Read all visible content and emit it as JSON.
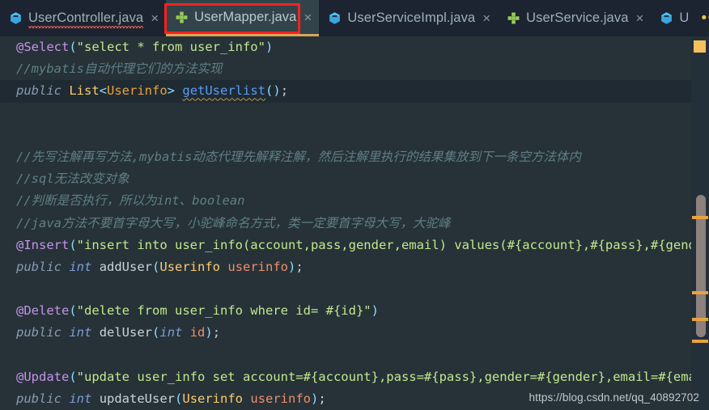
{
  "window": {
    "theme_background": "#263238",
    "tabbar_background": "#1b2430",
    "active_tab_background": "#32444a",
    "active_tab_underline": "#d8a657",
    "annotation_color": "#ff1f1f"
  },
  "tabbar": {
    "tabs": [
      {
        "label": "UserController.java",
        "icon": "java-class-icon",
        "close": "×",
        "active": false,
        "error_squiggle": true
      },
      {
        "label": "UserMapper.java",
        "icon": "mybatis-mapper-icon",
        "close": "×",
        "active": true,
        "error_squiggle": false
      },
      {
        "label": "UserServiceImpl.java",
        "icon": "java-class-icon",
        "close": "×",
        "active": false,
        "error_squiggle": false
      },
      {
        "label": "UserService.java",
        "icon": "mybatis-mapper-icon",
        "close": "×",
        "active": false,
        "error_squiggle": false
      },
      {
        "label": "U",
        "icon": "java-class-icon",
        "close": "",
        "active": false,
        "error_squiggle": false
      }
    ],
    "overflow": {
      "dots": "•••",
      "count": "2"
    }
  },
  "editor": {
    "language": "java",
    "current_line_index": 2,
    "lines": [
      {
        "tokens": [
          {
            "t": "@Select",
            "c": "t-ann"
          },
          {
            "t": "(",
            "c": "t-punc"
          },
          {
            "t": "\"select * from user_info\"",
            "c": "t-str"
          },
          {
            "t": ")",
            "c": "t-punc"
          }
        ]
      },
      {
        "tokens": [
          {
            "t": "//mybatis自动代理它们的方法实现",
            "c": "t-cmt"
          }
        ]
      },
      {
        "tokens": [
          {
            "t": "public",
            "c": "t-kw"
          },
          {
            "t": " ",
            "c": "t-plain"
          },
          {
            "t": "List",
            "c": "t-type"
          },
          {
            "t": "<",
            "c": "t-punc"
          },
          {
            "t": "Userinfo",
            "c": "t-type2"
          },
          {
            "t": ">",
            "c": "t-punc"
          },
          {
            "t": " ",
            "c": "t-plain"
          },
          {
            "t": "getUserlist",
            "c": "t-meth wsq"
          },
          {
            "t": "()",
            "c": "t-punc"
          },
          {
            "t": ";",
            "c": "t-plain"
          }
        ]
      },
      {
        "tokens": []
      },
      {
        "tokens": []
      },
      {
        "tokens": [
          {
            "t": "//先写注解再写方法,mybatis动态代理先解释注解，然后注解里执行的结果集放到下一条空方法体内",
            "c": "t-cmt"
          }
        ]
      },
      {
        "tokens": [
          {
            "t": "//sql无法改变对象",
            "c": "t-cmt"
          }
        ]
      },
      {
        "tokens": [
          {
            "t": "//判断是否执行，所以为int、boolean",
            "c": "t-cmt"
          }
        ]
      },
      {
        "tokens": [
          {
            "t": "//java方法不要首字母大写，小驼峰命名方式，类一定要首字母大写，大驼峰",
            "c": "t-cmt"
          }
        ]
      },
      {
        "tokens": [
          {
            "t": "@Insert",
            "c": "t-ann"
          },
          {
            "t": "(",
            "c": "t-punc"
          },
          {
            "t": "\"insert into user_info(account,pass,gender,email) values(#{account},#{pass},#{gender},#{email})\"",
            "c": "t-str"
          },
          {
            "t": ")",
            "c": "t-punc"
          }
        ]
      },
      {
        "tokens": [
          {
            "t": "public",
            "c": "t-kw"
          },
          {
            "t": " ",
            "c": "t-plain"
          },
          {
            "t": "int",
            "c": "t-kw2"
          },
          {
            "t": " ",
            "c": "t-plain"
          },
          {
            "t": "addUser",
            "c": "t-plain"
          },
          {
            "t": "(",
            "c": "t-punc"
          },
          {
            "t": "Userinfo",
            "c": "t-type"
          },
          {
            "t": " ",
            "c": "t-plain"
          },
          {
            "t": "userinfo",
            "c": "t-param"
          },
          {
            "t": ")",
            "c": "t-punc"
          },
          {
            "t": ";",
            "c": "t-plain"
          }
        ]
      },
      {
        "tokens": []
      },
      {
        "tokens": [
          {
            "t": "@Delete",
            "c": "t-ann"
          },
          {
            "t": "(",
            "c": "t-punc"
          },
          {
            "t": "\"delete from user_info where id= #{id}\"",
            "c": "t-str"
          },
          {
            "t": ")",
            "c": "t-punc"
          }
        ]
      },
      {
        "tokens": [
          {
            "t": "public",
            "c": "t-kw"
          },
          {
            "t": " ",
            "c": "t-plain"
          },
          {
            "t": "int",
            "c": "t-kw2"
          },
          {
            "t": " ",
            "c": "t-plain"
          },
          {
            "t": "delUser",
            "c": "t-plain"
          },
          {
            "t": "(",
            "c": "t-punc"
          },
          {
            "t": "int",
            "c": "t-kw2"
          },
          {
            "t": " ",
            "c": "t-plain"
          },
          {
            "t": "id",
            "c": "t-param"
          },
          {
            "t": ")",
            "c": "t-punc"
          },
          {
            "t": ";",
            "c": "t-plain"
          }
        ]
      },
      {
        "tokens": []
      },
      {
        "tokens": [
          {
            "t": "@Update",
            "c": "t-ann"
          },
          {
            "t": "(",
            "c": "t-punc"
          },
          {
            "t": "\"update user_info set account=#{account},pass=#{pass},gender=#{gender},email=#{email} where id=#{id}\"",
            "c": "t-str"
          },
          {
            "t": ")",
            "c": "t-punc"
          }
        ]
      },
      {
        "tokens": [
          {
            "t": "public",
            "c": "t-kw"
          },
          {
            "t": " ",
            "c": "t-plain"
          },
          {
            "t": "int",
            "c": "t-kw2"
          },
          {
            "t": " ",
            "c": "t-plain"
          },
          {
            "t": "updateUser",
            "c": "t-plain"
          },
          {
            "t": "(",
            "c": "t-punc"
          },
          {
            "t": "Userinfo",
            "c": "t-type"
          },
          {
            "t": " ",
            "c": "t-plain"
          },
          {
            "t": "userinfo",
            "c": "t-param"
          },
          {
            "t": ")",
            "c": "t-punc"
          },
          {
            "t": ";",
            "c": "t-plain"
          }
        ]
      }
    ]
  },
  "gutter": {
    "warning_marker_color": "#f5c15e",
    "scrollbar_thumb_color": "#8d817d",
    "tick_color": "#e8a33d",
    "ticks_top": [
      222,
      315,
      348,
      375
    ]
  },
  "watermark": {
    "text": "https://blog.csdn.net/qq_40892702"
  }
}
